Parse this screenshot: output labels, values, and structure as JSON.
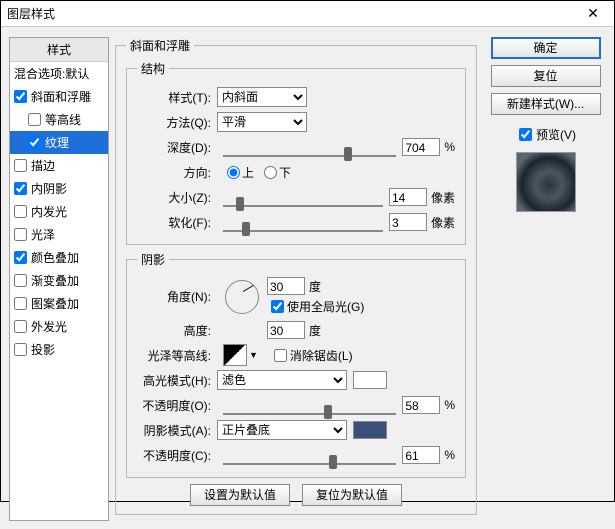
{
  "window": {
    "title": "图层样式",
    "close": "✕"
  },
  "left": {
    "header": "样式",
    "blend": "混合选项:默认",
    "items": [
      {
        "label": "斜面和浮雕",
        "checked": true,
        "selected": false,
        "indent": false
      },
      {
        "label": "等高线",
        "checked": false,
        "selected": false,
        "indent": true
      },
      {
        "label": "纹理",
        "checked": true,
        "selected": true,
        "indent": true
      },
      {
        "label": "描边",
        "checked": false,
        "selected": false,
        "indent": false
      },
      {
        "label": "内阴影",
        "checked": true,
        "selected": false,
        "indent": false
      },
      {
        "label": "内发光",
        "checked": false,
        "selected": false,
        "indent": false
      },
      {
        "label": "光泽",
        "checked": false,
        "selected": false,
        "indent": false
      },
      {
        "label": "颜色叠加",
        "checked": true,
        "selected": false,
        "indent": false
      },
      {
        "label": "渐变叠加",
        "checked": false,
        "selected": false,
        "indent": false
      },
      {
        "label": "图案叠加",
        "checked": false,
        "selected": false,
        "indent": false
      },
      {
        "label": "外发光",
        "checked": false,
        "selected": false,
        "indent": false
      },
      {
        "label": "投影",
        "checked": false,
        "selected": false,
        "indent": false
      }
    ]
  },
  "right": {
    "ok": "确定",
    "reset": "复位",
    "newstyle": "新建样式(W)...",
    "preview": "预览(V)"
  },
  "main": {
    "groupTitle": "斜面和浮雕",
    "struct": {
      "title": "结构",
      "styleLbl": "样式(T):",
      "styleVal": "内斜面",
      "methodLbl": "方法(Q):",
      "methodVal": "平滑",
      "depthLbl": "深度(D):",
      "depthVal": "704",
      "depthUnit": "%",
      "dirLbl": "方向:",
      "up": "上",
      "down": "下",
      "sizeLbl": "大小(Z):",
      "sizeVal": "14",
      "sizeUnit": "像素",
      "softLbl": "软化(F):",
      "softVal": "3",
      "softUnit": "像素"
    },
    "shade": {
      "title": "阴影",
      "angleLbl": "角度(N):",
      "angleVal": "30",
      "angleUnit": "度",
      "globalLbl": "使用全局光(G)",
      "altLbl": "高度:",
      "altVal": "30",
      "altUnit": "度",
      "glossLbl": "光泽等高线:",
      "antiLbl": "消除锯齿(L)",
      "hlModeLbl": "高光模式(H):",
      "hlModeVal": "滤色",
      "hlColor": "#ffffff",
      "hlOpLbl": "不透明度(O):",
      "hlOpVal": "58",
      "opUnit": "%",
      "shModeLbl": "阴影模式(A):",
      "shModeVal": "正片叠底",
      "shColor": "#3a4f7a",
      "shOpLbl": "不透明度(C):",
      "shOpVal": "61"
    },
    "defaults": {
      "set": "设置为默认值",
      "reset": "复位为默认值"
    }
  }
}
